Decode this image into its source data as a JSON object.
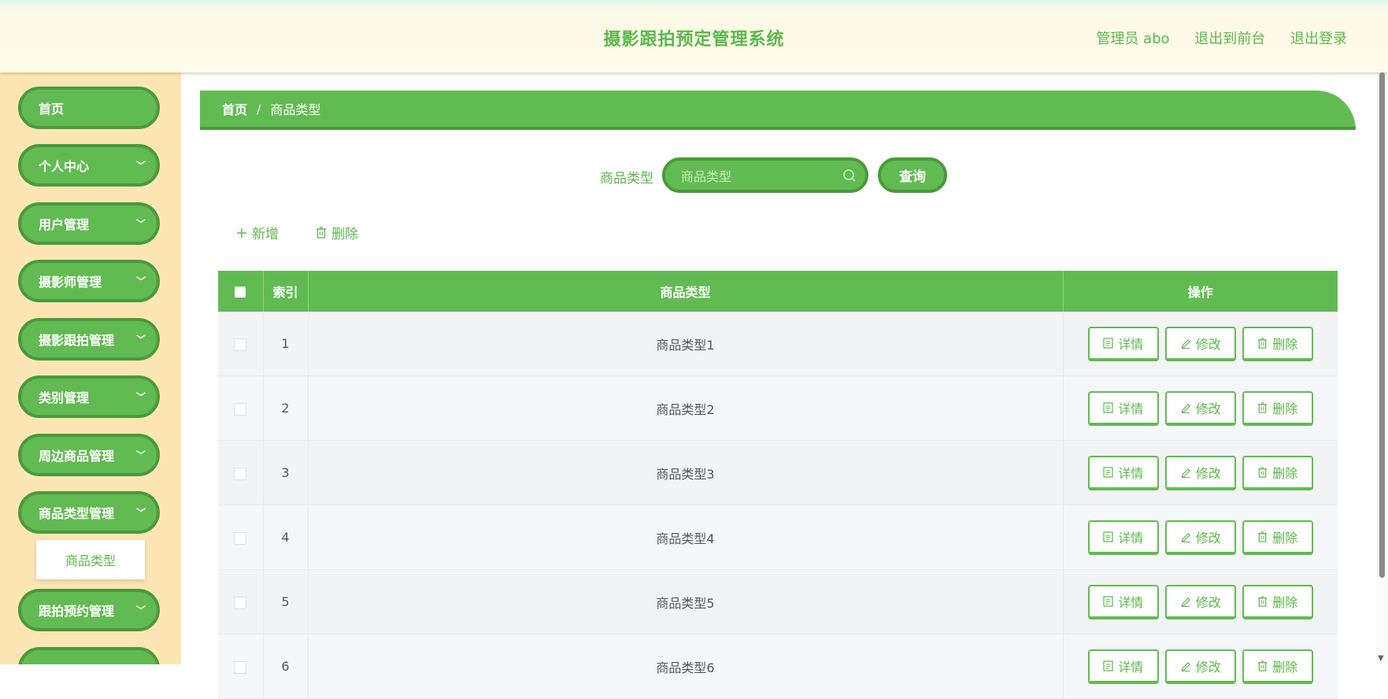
{
  "header": {
    "title": "摄影跟拍预定管理系统",
    "admin": "管理员 abo",
    "to_front": "退出到前台",
    "logout": "退出登录"
  },
  "sidebar": {
    "items": [
      {
        "label": "首页"
      },
      {
        "label": "个人中心"
      },
      {
        "label": "用户管理"
      },
      {
        "label": "摄影师管理"
      },
      {
        "label": "摄影跟拍管理"
      },
      {
        "label": "类别管理"
      },
      {
        "label": "周边商品管理"
      },
      {
        "label": "商品类型管理"
      },
      {
        "label": "跟拍预约管理"
      },
      {
        "label": ""
      }
    ],
    "submenu": {
      "label": "商品类型"
    }
  },
  "breadcrumb": {
    "home": "首页",
    "sep": "/",
    "current": "商品类型"
  },
  "search": {
    "label": "商品类型",
    "placeholder": "商品类型",
    "button": "查询"
  },
  "actions": {
    "add": "新增",
    "delete": "删除"
  },
  "table": {
    "headers": {
      "index": "索引",
      "type": "商品类型",
      "ops": "操作"
    },
    "op_labels": {
      "detail": "详情",
      "edit": "修改",
      "delete": "删除"
    },
    "rows": [
      {
        "index": "1",
        "type": "商品类型1"
      },
      {
        "index": "2",
        "type": "商品类型2"
      },
      {
        "index": "3",
        "type": "商品类型3"
      },
      {
        "index": "4",
        "type": "商品类型4"
      },
      {
        "index": "5",
        "type": "商品类型5"
      },
      {
        "index": "6",
        "type": "商品类型6"
      }
    ]
  },
  "colors": {
    "primary": "#62bb52",
    "primary_dark": "#4a9a3a",
    "sidebar_bg": "#fde6b4",
    "header_bg": "#fffbea"
  }
}
